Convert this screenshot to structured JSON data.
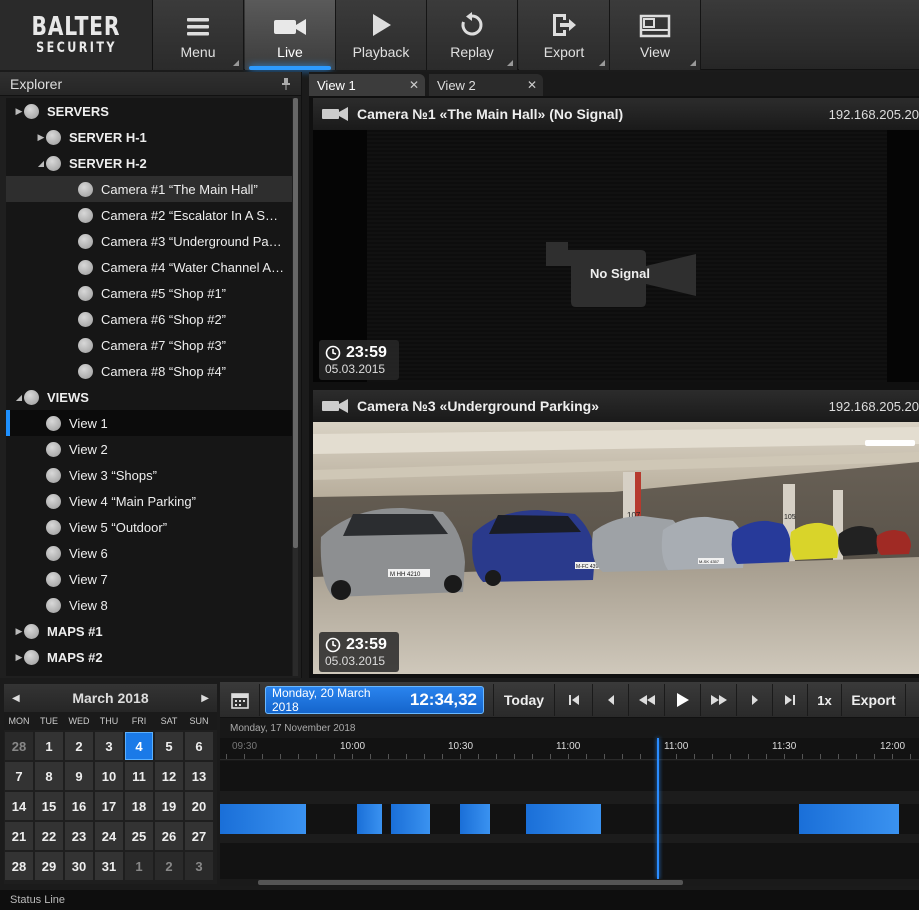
{
  "logo": {
    "line1": "BALTER",
    "line2": "SECURITY"
  },
  "toolbar": [
    {
      "label": "Menu",
      "icon": "menu-icon",
      "has_dropdown": true
    },
    {
      "label": "Live",
      "icon": "camera-icon",
      "active": true
    },
    {
      "label": "Playback",
      "icon": "play-icon"
    },
    {
      "label": "Replay",
      "icon": "replay-icon",
      "has_dropdown": true
    },
    {
      "label": "Export",
      "icon": "export-icon",
      "has_dropdown": true
    },
    {
      "label": "View",
      "icon": "view-layout-icon",
      "has_dropdown": true
    }
  ],
  "explorer": {
    "title": "Explorer",
    "items": [
      {
        "label": "SERVERS",
        "level": 0,
        "bold": true,
        "expand": "collapsed"
      },
      {
        "label": "SERVER H-1",
        "level": 1,
        "bold": true,
        "expand": "collapsed"
      },
      {
        "label": "SERVER H-2",
        "level": 1,
        "bold": true,
        "expand": "expanded"
      },
      {
        "label": "Camera #1 “The Main Hall”",
        "level": 2,
        "selected": "light"
      },
      {
        "label": "Camera #2 “Escalator In A Shopping Mall”",
        "level": 2
      },
      {
        "label": "Camera #3 “Underground Parking”",
        "level": 2
      },
      {
        "label": "Camera #4 “Water Channel At The Entrance”",
        "level": 2
      },
      {
        "label": "Camera #5 “Shop #1”",
        "level": 2
      },
      {
        "label": "Camera #6 “Shop #2”",
        "level": 2
      },
      {
        "label": "Camera #7 “Shop #3”",
        "level": 2
      },
      {
        "label": "Camera #8 “Shop #4”",
        "level": 2
      },
      {
        "label": "VIEWS",
        "level": 0,
        "bold": true,
        "expand": "expanded"
      },
      {
        "label": "View 1",
        "level": 1,
        "selected": "dark"
      },
      {
        "label": "View 2",
        "level": 1
      },
      {
        "label": "View 3 “Shops”",
        "level": 1
      },
      {
        "label": "View 4 “Main Parking”",
        "level": 1
      },
      {
        "label": "View 5 “Outdoor”",
        "level": 1
      },
      {
        "label": "View 6",
        "level": 1
      },
      {
        "label": "View 7",
        "level": 1
      },
      {
        "label": "View 8",
        "level": 1
      },
      {
        "label": "MAPS #1",
        "level": 0,
        "bold": true,
        "expand": "collapsed"
      },
      {
        "label": "MAPS #2",
        "level": 0,
        "bold": true,
        "expand": "collapsed"
      }
    ]
  },
  "tabs": [
    {
      "label": "View 1",
      "active": true
    },
    {
      "label": "View 2",
      "active": false
    }
  ],
  "cameras": [
    {
      "title": "Camera №1 «The Main Hall» (No Signal)",
      "ip": "192.168.205.20",
      "no_signal_text": "No Signal",
      "time": "23:59",
      "date": "05.03.2015"
    },
    {
      "title": "Camera №3 «Underground Parking»",
      "ip": "192.168.205.20",
      "time": "23:59",
      "date": "05.03.2015",
      "plates": [
        "M HH 4210",
        "M-FC 439",
        "M-SK 4357"
      ],
      "signs": [
        "107",
        "105"
      ]
    }
  ],
  "calendar": {
    "month": "March 2018",
    "weekdays": [
      "MON",
      "TUE",
      "WED",
      "THU",
      "FRI",
      "SAT",
      "SUN"
    ],
    "weeks": [
      [
        "28",
        "1",
        "2",
        "3",
        "4",
        "5",
        "6"
      ],
      [
        "7",
        "8",
        "9",
        "10",
        "11",
        "12",
        "13"
      ],
      [
        "14",
        "15",
        "16",
        "17",
        "18",
        "19",
        "20"
      ],
      [
        "21",
        "22",
        "23",
        "24",
        "25",
        "26",
        "27"
      ],
      [
        "28",
        "29",
        "30",
        "31",
        "1",
        "2",
        "3"
      ]
    ],
    "selected_day": "4",
    "other_month": [
      [
        0,
        0
      ],
      [
        4,
        4
      ],
      [
        4,
        5
      ],
      [
        4,
        6
      ]
    ]
  },
  "timeline": {
    "current_date": "Monday, 20 March 2018",
    "current_time": "12:34,32",
    "today_label": "Today",
    "speed": "1x",
    "export_label": "Export",
    "ruler_date": "Monday, 17 November 2018",
    "ruler_labels": [
      "09:30",
      "10:00",
      "10:30",
      "11:00",
      "11:00",
      "11:30",
      "12:00"
    ],
    "accent": "#1e88ff"
  },
  "status_line": "Status Line"
}
